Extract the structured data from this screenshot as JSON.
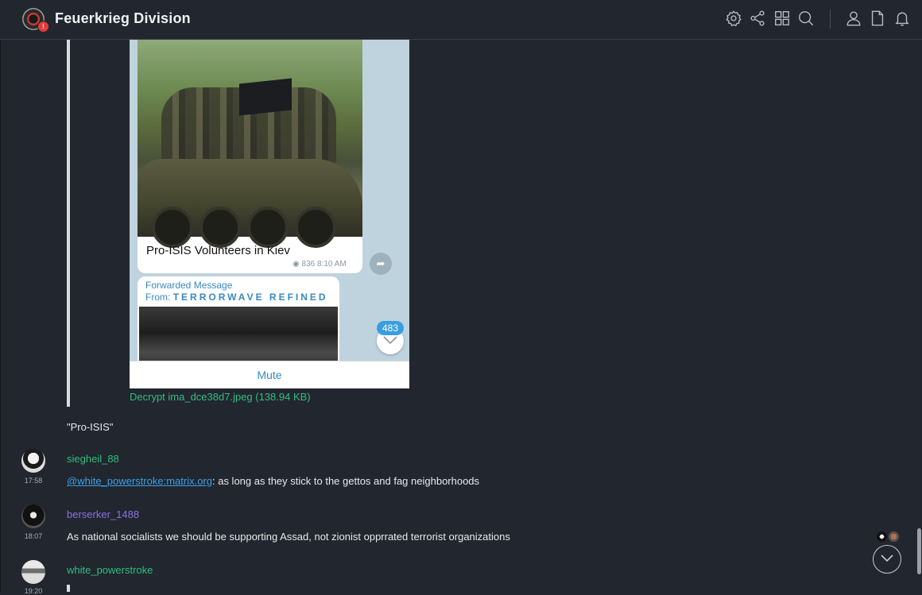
{
  "header": {
    "room_name": "Feuerkrieg Division",
    "room_badge": "!",
    "icons": [
      "settings-icon",
      "share-icon",
      "apps-grid-icon",
      "search-icon",
      "user-icon",
      "file-icon",
      "bell-icon"
    ]
  },
  "image": {
    "caption": "Pro-ISIS Volunteers in Kiev",
    "meta": "836 8:10 AM",
    "forwarded_label": "Forwarded Message",
    "forwarded_from_prefix": "From:",
    "forwarded_from": "TERRORWAVE REFINED",
    "unread_count": "483",
    "mute_label": "Mute"
  },
  "decrypt_link": "Decrypt ima_dce38d7.jpeg (138.94 KB)",
  "messages": [
    {
      "body": "\"Pro-ISIS\""
    },
    {
      "sender": "siegheil_88",
      "time": "17:58",
      "mention": "@white_powerstroke:matrix.org",
      "body": ": as long as they stick to the gettos and fag neighborhoods"
    },
    {
      "sender": "berserker_1488",
      "time": "18:07",
      "body": "As national socialists we should be supporting Assad, not zionist opprrated terrorist organizations"
    },
    {
      "sender": "white_powerstroke",
      "time": "19:20"
    }
  ],
  "colors": {
    "background": "#22262e",
    "sender_green": "#2fbf7f",
    "sender_purple": "#8a70e6",
    "link_blue": "#3aa0e8",
    "telegram_blue": "#3a88c3"
  }
}
